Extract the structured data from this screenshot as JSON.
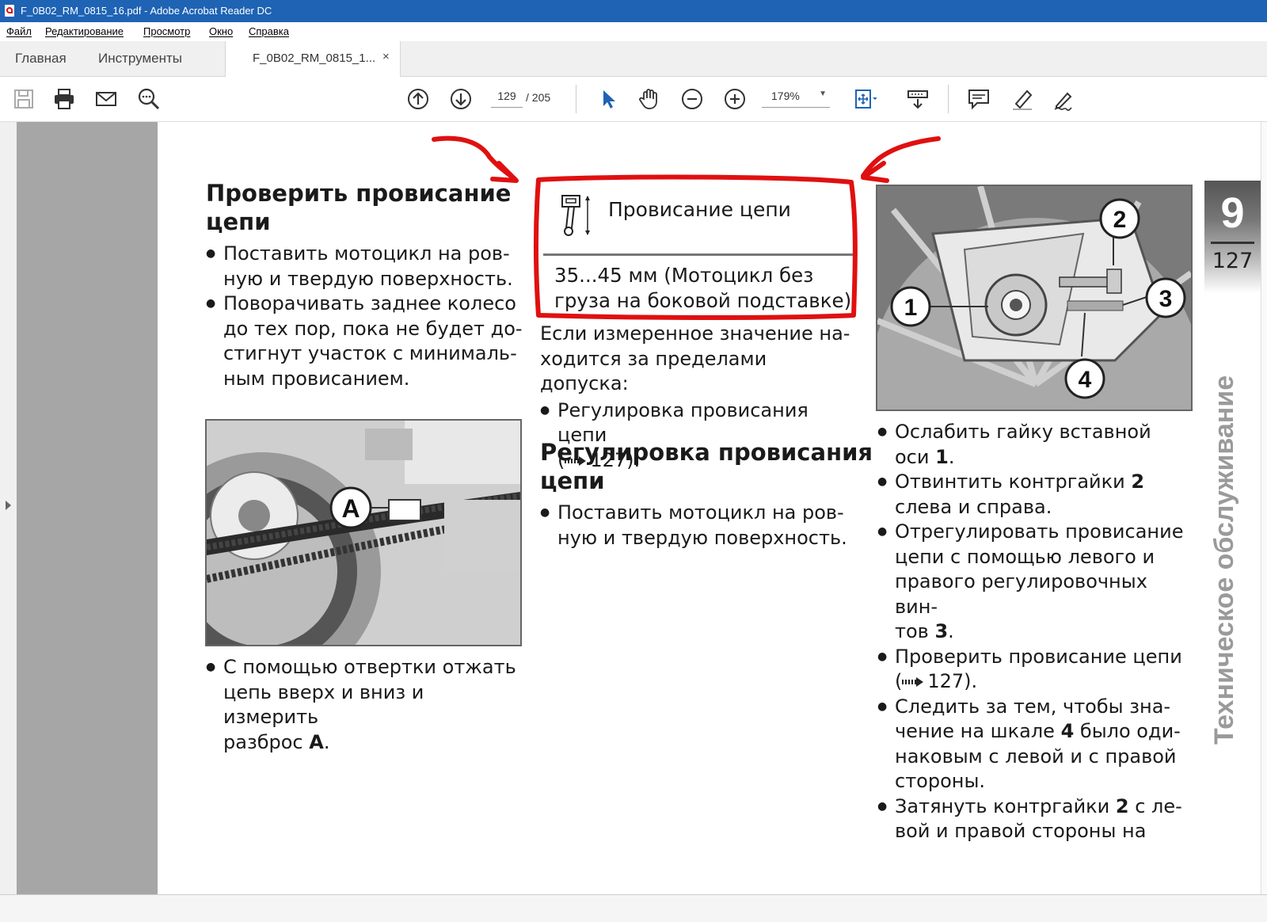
{
  "window": {
    "title": "F_0B02_RM_0815_16.pdf - Adobe Acrobat Reader DC"
  },
  "menu": [
    "Файл",
    "Редактирование",
    "Просмотр",
    "Окно",
    "Справка"
  ],
  "tabs": {
    "home": "Главная",
    "tools": "Инструменты",
    "document": "F_0B02_RM_0815_1...",
    "close": "×"
  },
  "toolbar": {
    "page_current": "129",
    "page_total": "/  205",
    "zoom": "179%",
    "icons": [
      "save-icon",
      "print-icon",
      "email-icon",
      "search-icon",
      "page-up-icon",
      "page-down-icon",
      "select-cursor-icon",
      "hand-icon",
      "zoom-out-icon",
      "zoom-in-icon",
      "fit-page-icon",
      "scroll-mode-icon",
      "comment-icon",
      "highlight-icon",
      "sign-icon"
    ]
  },
  "page": {
    "left": {
      "heading": [
        "Проверить провисание",
        "цепи"
      ],
      "bullets": [
        [
          "Поставить мотоцикл на ров-",
          "ную и твердую поверхность."
        ],
        [
          "Поворачивать заднее колесо",
          "до тех пор, пока не будет до-",
          "стигнут участок с минималь-",
          "ным провисанием."
        ]
      ],
      "figure_label": "A",
      "caption_bullet": [
        "С помощью отвертки отжать",
        "цепь вверх и вниз и измерить",
        "разброс "
      ],
      "caption_bold": "A",
      "caption_end": "."
    },
    "middle": {
      "spec_title": "Провисание цепи",
      "spec_value": [
        "35...45 мм (Мотоцикл без",
        "груза на боковой подставке)"
      ],
      "text": [
        "Если измеренное значение на-",
        "ходится за пределами допуска:"
      ],
      "bullet_ref": [
        "Регулировка провисания цепи",
        "127)."
      ],
      "heading": [
        "Регулировка провисания",
        "цепи"
      ],
      "bullet2": [
        "Поставить мотоцикл на ров-",
        "ную и твердую поверхность."
      ]
    },
    "right": {
      "figure_labels": [
        "1",
        "2",
        "3",
        "4"
      ],
      "bullets": [
        {
          "lines": [
            "Ослабить гайку вставной",
            "оси "
          ],
          "bold": "1",
          "end": "."
        },
        {
          "lines": [
            "Отвинтить контргайки ",
            "слева и справа."
          ],
          "bold": "2",
          "end": ""
        },
        {
          "lines": [
            "Отрегулировать провисание",
            "цепи с помощью левого и",
            "правого регулировочных вин-",
            "тов "
          ],
          "bold": "3",
          "end": "."
        },
        {
          "lines": [
            "Проверить провисание цепи",
            "127)."
          ]
        },
        {
          "lines": [
            "Следить за тем, чтобы зна-",
            "чение на шкале ",
            " было оди-",
            "наковым с левой и с правой",
            "стороны."
          ],
          "bold": "4"
        },
        {
          "lines": [
            "Затянуть контргайки ",
            " с ле-",
            "вой и правой стороны на"
          ],
          "bold": "2"
        }
      ]
    },
    "chapter": {
      "number": "9",
      "page": "127",
      "vertical_title": "Техническое обслуживание"
    }
  },
  "annotation_color": "#e01010"
}
